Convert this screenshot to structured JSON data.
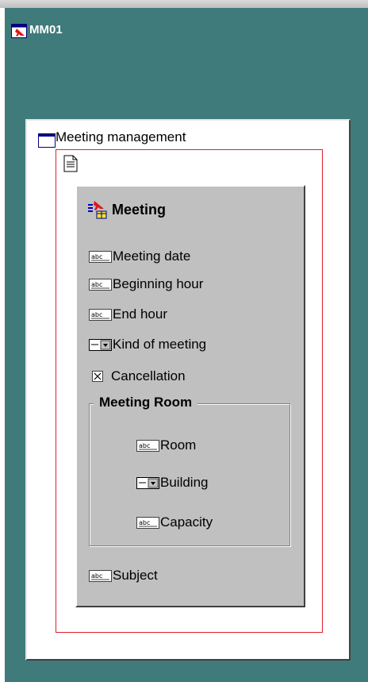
{
  "app": {
    "title": "MM01"
  },
  "panel": {
    "title": "Meeting management"
  },
  "group": {
    "title": "Meeting",
    "fields": [
      {
        "label": "Meeting date",
        "icon": "text-field-icon"
      },
      {
        "label": "Beginning hour",
        "icon": "text-field-icon"
      },
      {
        "label": "End hour",
        "icon": "text-field-icon"
      },
      {
        "label": "Kind of meeting",
        "icon": "combo-box-icon"
      },
      {
        "label": "Cancellation",
        "icon": "checkbox-icon"
      }
    ],
    "subgroup": {
      "title": "Meeting Room",
      "fields": [
        {
          "label": "Room",
          "icon": "text-field-icon"
        },
        {
          "label": "Building",
          "icon": "combo-box-icon"
        },
        {
          "label": "Capacity",
          "icon": "text-field-icon"
        }
      ]
    },
    "subject": {
      "label": "Subject",
      "icon": "text-field-icon"
    }
  },
  "colors": {
    "workspace": "#3f7b7a",
    "group_background": "#c0c0c0",
    "selection_border": "#e0202a"
  }
}
